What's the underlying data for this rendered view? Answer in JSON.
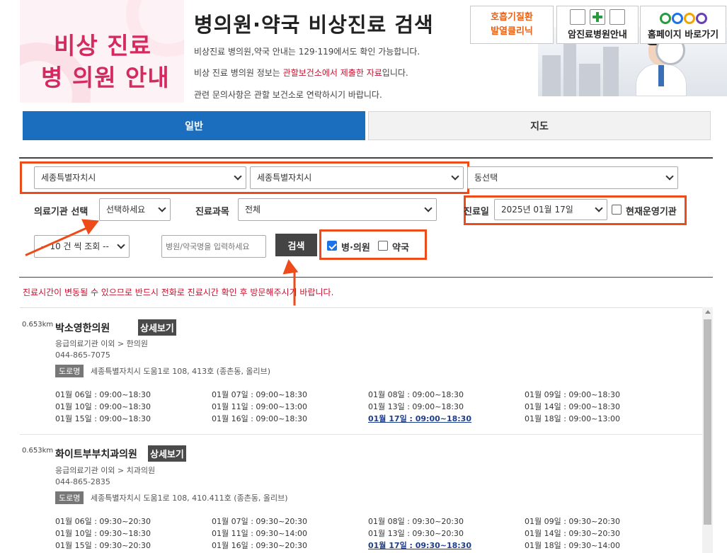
{
  "header": {
    "logo_line1": "비상 진료",
    "logo_line2": "병 의원 안내",
    "title": "병의원·약국 비상진료 검색",
    "desc1": "비상진료 병의원,약국 안내는 129·119에서도 확인 가능합니다.",
    "desc2_pre": "비상 진료 병의원 정보는 ",
    "desc2_red": "관할보건소에서 제출한 자료",
    "desc2_post": "입니다.",
    "desc3": "관련 문의사항은 관할 보건소로 연락하시기 바랍니다."
  },
  "banners": {
    "b1_line1": "호흡기질환",
    "b1_line2": "발열클리닉",
    "b2_label": "암진료병원안내",
    "b3_label": "홈페이지 바로가기"
  },
  "tabs": {
    "general": "일반",
    "map": "지도"
  },
  "search": {
    "sido_value": "세종특별자치시",
    "sigungu_value": "세종특별자치시",
    "dong_value": "동선택",
    "inst_label": "의료기관 선택",
    "inst_value": "선택하세요",
    "subject_label": "진료과목",
    "subject_value": "전체",
    "date_label": "진료일",
    "date_value": "2025년 01월 17일",
    "open_now_label": "현재운영기관",
    "page_size_value": "-- 10 건 씩 조회 --",
    "name_placeholder": "병원/약국명을 입력하세요",
    "search_button": "검색",
    "hospital_label": "병·의원",
    "pharmacy_label": "약국",
    "hospital_checked": true,
    "pharmacy_checked": false,
    "open_now_checked": false
  },
  "notice": "진료시간이 변동될 수 있으므로 반드시 전화로 진료시간 확인 후 방문해주시기 바랍니다.",
  "results": [
    {
      "distance": "0.653km",
      "name": "박소영한의원",
      "detail": "상세보기",
      "category": "응급의료기관 이외 > 한의원",
      "phone": "044-865-7075",
      "road_label": "도로명",
      "address": "세종특별자치시 도움1로 108, 413호 (종촌동, 올리브)",
      "schedule": [
        "01월 06일 : 09:00~18:30",
        "01월 07일 : 09:00~18:30",
        "01월 08일 : 09:00~18:30",
        "01월 09일 : 09:00~18:30",
        "01월 10일 : 09:00~18:30",
        "01월 11일 : 09:00~13:00",
        "01월 13일 : 09:00~18:30",
        "01월 14일 : 09:00~18:30",
        "01월 15일 : 09:00~18:30",
        "01월 16일 : 09:00~18:30",
        "01월 17일 : 09:00~18:30",
        "01월 18일 : 09:00~13:00"
      ],
      "today_index": 10
    },
    {
      "distance": "0.653km",
      "name": "화이트부부치과의원",
      "detail": "상세보기",
      "category": "응급의료기관 이외 > 치과의원",
      "phone": "044-865-2835",
      "road_label": "도로명",
      "address": "세종특별자치시 도움1로 108, 410.411호 (종촌동, 올리브)",
      "schedule": [
        "01월 06일 : 09:30~20:30",
        "01월 07일 : 09:30~20:30",
        "01월 08일 : 09:30~20:30",
        "01월 09일 : 09:30~20:30",
        "01월 10일 : 09:30~18:30",
        "01월 11일 : 09:30~14:00",
        "01월 13일 : 09:30~20:30",
        "01월 14일 : 09:30~20:30",
        "01월 15일 : 09:30~20:30",
        "01월 16일 : 09:30~20:30",
        "01월 17일 : 09:30~18:30",
        "01월 18일 : 09:30~14:00"
      ],
      "today_index": 10
    }
  ],
  "colors": {
    "accent_blue": "#1a6ebd",
    "highlight_orange": "#ee4b1a",
    "brand_pink": "#d42a5f",
    "notice_red": "#c8102e"
  }
}
